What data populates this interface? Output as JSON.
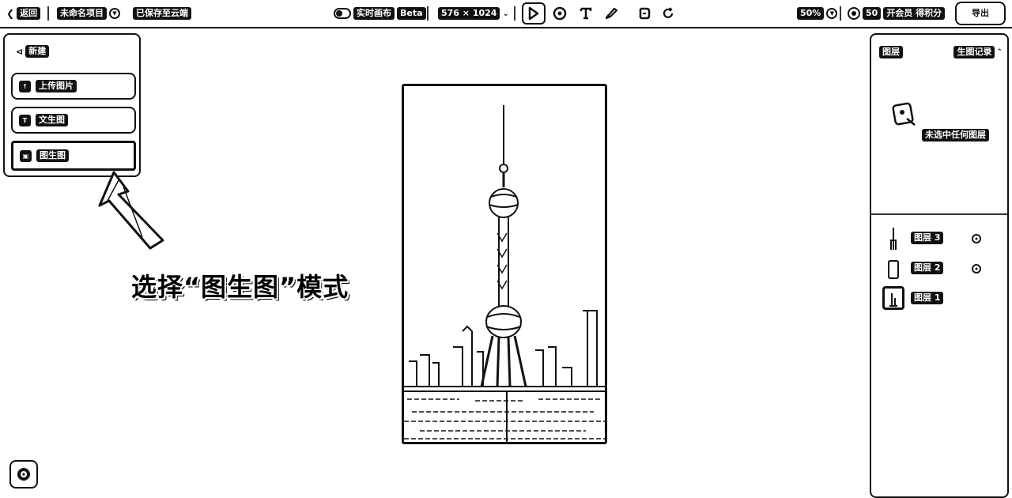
{
  "toolbar": {
    "back_label": "返回",
    "project_name": "未命名项目",
    "save_status": "已保存至云端",
    "realtime_label": "实时画布",
    "beta_badge": "Beta",
    "canvas_size": "576 × 1024",
    "zoom": "50%",
    "credits": "50",
    "vip_label": "开会员 得积分",
    "export_label": "导出",
    "tools": [
      "select-tool",
      "shape-tool",
      "text-tool",
      "brush-tool",
      "crop-tool",
      "redo-tool"
    ]
  },
  "left_panel": {
    "header": "新建",
    "modes": [
      {
        "label": "上传图片",
        "icon": "upload-image-icon"
      },
      {
        "label": "文生图",
        "icon": "text-to-image-icon"
      },
      {
        "label": "图生图",
        "icon": "image-to-image-icon",
        "selected": true
      }
    ]
  },
  "annotation": {
    "text": "选择“图生图”模式"
  },
  "right_panel": {
    "tab_layers": "图层",
    "tab_history": "生图记录",
    "empty_text": "未选中任何图层",
    "layers": [
      {
        "label": "图层 3",
        "visible_icon": "eye-icon"
      },
      {
        "label": "图层 2",
        "visible_icon": "eye-icon"
      },
      {
        "label": "图层 1",
        "active": true
      }
    ]
  },
  "colors": {
    "ink": "#111111",
    "background": "#ffffff"
  }
}
